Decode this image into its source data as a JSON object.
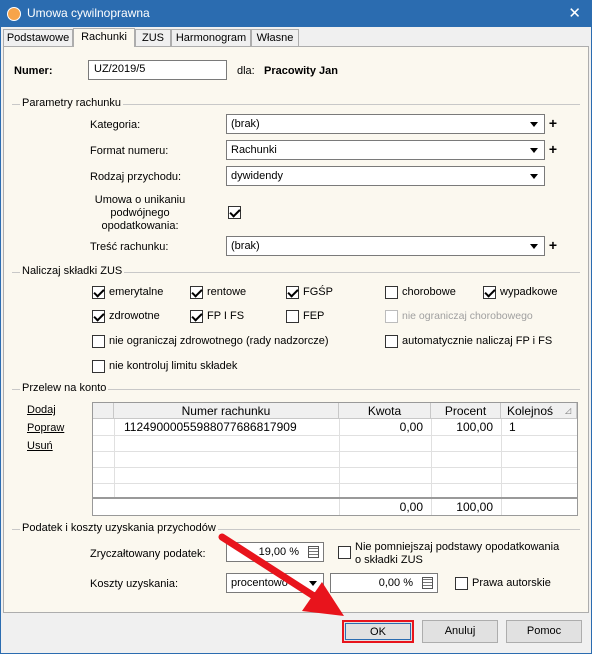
{
  "window": {
    "title": "Umowa cywilnoprawna",
    "close_glyph": "✕"
  },
  "tabs": [
    "Podstawowe",
    "Rachunki",
    "ZUS",
    "Harmonogram",
    "Własne"
  ],
  "header": {
    "numer_label": "Numer:",
    "numer_value": "UZ/2019/5",
    "dla_label": "dla:",
    "dla_value": "Pracowity Jan"
  },
  "parametry": {
    "title": "Parametry rachunku",
    "kategoria_label": "Kategoria:",
    "kategoria_value": "(brak)",
    "format_label": "Format numeru:",
    "format_value": "Rachunki",
    "rodzaj_label": "Rodzaj przychodu:",
    "rodzaj_value": "dywidendy",
    "umowa_label_1": "Umowa o unikaniu",
    "umowa_label_2": "podwójnego",
    "umowa_label_3": "opodatkowania:",
    "umowa_checked": true,
    "tresc_label": "Treść rachunku:",
    "tresc_value": "(brak)"
  },
  "zus": {
    "title": "Naliczaj składki ZUS",
    "emerytalne": "emerytalne",
    "rentowe": "rentowe",
    "fgsp": "FGŚP",
    "chorobowe": "chorobowe",
    "wypadkowe": "wypadkowe",
    "zdrowotne": "zdrowotne",
    "fpifs": "FP I FS",
    "fep": "FEP",
    "nie_ogr_chor": "nie ograniczaj chorobowego",
    "nie_ogr_zdrow": "nie ograniczaj zdrowotnego (rady nadzorcze)",
    "auto_fp": "automatycznie naliczaj FP i FS",
    "nie_kontroluj": "nie kontroluj limitu składek"
  },
  "przelew": {
    "title": "Przelew na konto",
    "dodaj": "Dodaj",
    "popraw": "Popraw",
    "usun": "Usuń",
    "columns": [
      "Numer rachunku",
      "Kwota",
      "Procent",
      "Kolejnoś"
    ],
    "rows": [
      {
        "numer": "11249000055988077686817909",
        "kwota": "0,00",
        "procent": "100,00",
        "kolejnosc": "1"
      }
    ],
    "footer": {
      "kwota": "0,00",
      "procent": "100,00"
    }
  },
  "podatek": {
    "title": "Podatek i koszty uzyskania przychodów",
    "zrycz_label": "Zryczałtowany podatek:",
    "zrycz_value": "19,00 %",
    "nie_pomniejszaj_1": "Nie pomniejszaj podstawy opodatkowania",
    "nie_pomniejszaj_2": "o składki ZUS",
    "koszty_label": "Koszty uzyskania:",
    "koszty_type": "procentowo",
    "koszty_value": "0,00 %",
    "prawa_autorskie": "Prawa autorskie"
  },
  "buttons": {
    "ok": "OK",
    "anuluj": "Anuluj",
    "pomoc": "Pomoc"
  },
  "icons": [
    "app-icon",
    "close-icon",
    "dropdown-arrow-icon",
    "plus-icon",
    "calculator-icon",
    "sort-icon",
    "annotation-arrow"
  ],
  "colors": {
    "titlebar": "#2b6cb0",
    "panel": "#fbf8ef",
    "highlight": "#e8141c"
  }
}
